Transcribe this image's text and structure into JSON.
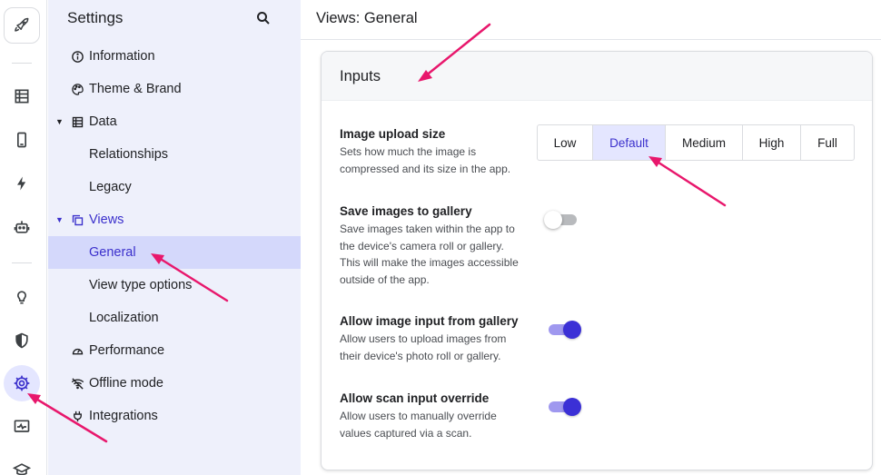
{
  "colors": {
    "accent": "#3b30cc",
    "sidebar_bg": "#eef0fb",
    "selected_bg": "#d4d8fb",
    "annotation": "#e8176c"
  },
  "rail": {
    "items": [
      {
        "icon": "rocket-icon"
      },
      {
        "icon": "table-icon"
      },
      {
        "icon": "mobile-icon"
      },
      {
        "icon": "lightning-icon"
      },
      {
        "icon": "robot-icon"
      },
      {
        "icon": "lightbulb-icon"
      },
      {
        "icon": "shield-icon"
      },
      {
        "icon": "gear-icon",
        "active": true
      },
      {
        "icon": "monitor-activity-icon"
      },
      {
        "icon": "graduation-cap-icon"
      }
    ]
  },
  "sidebar": {
    "title": "Settings",
    "search_icon": "search-icon",
    "items": [
      {
        "label": "Information",
        "icon": "info-icon"
      },
      {
        "label": "Theme & Brand",
        "icon": "palette-icon"
      },
      {
        "label": "Data",
        "icon": "table-icon",
        "expanded": true
      },
      {
        "label": "Relationships"
      },
      {
        "label": "Legacy"
      },
      {
        "label": "Views",
        "icon": "copy-icon",
        "expanded": true
      },
      {
        "label": "General",
        "selected": true
      },
      {
        "label": "View type options"
      },
      {
        "label": "Localization"
      },
      {
        "label": "Performance",
        "icon": "speedometer-icon"
      },
      {
        "label": "Offline mode",
        "icon": "wifi-off-icon"
      },
      {
        "label": "Integrations",
        "icon": "plug-icon"
      }
    ]
  },
  "main": {
    "title": "Views: General",
    "card": {
      "title": "Inputs",
      "settings": [
        {
          "title": "Image upload size",
          "desc": "Sets how much the image is compressed and its size in the app.",
          "options": [
            "Low",
            "Default",
            "Medium",
            "High",
            "Full"
          ],
          "selected": "Default"
        },
        {
          "title": "Save images to gallery",
          "desc": "Save images taken within the app to the device's camera roll or gallery. This will make the images accessible outside of the app.",
          "enabled": false
        },
        {
          "title": "Allow image input from gallery",
          "desc": "Allow users to upload images from their device's photo roll or gallery.",
          "enabled": true
        },
        {
          "title": "Allow scan input override",
          "desc": "Allow users to manually override values captured via a scan.",
          "enabled": true
        }
      ]
    }
  }
}
